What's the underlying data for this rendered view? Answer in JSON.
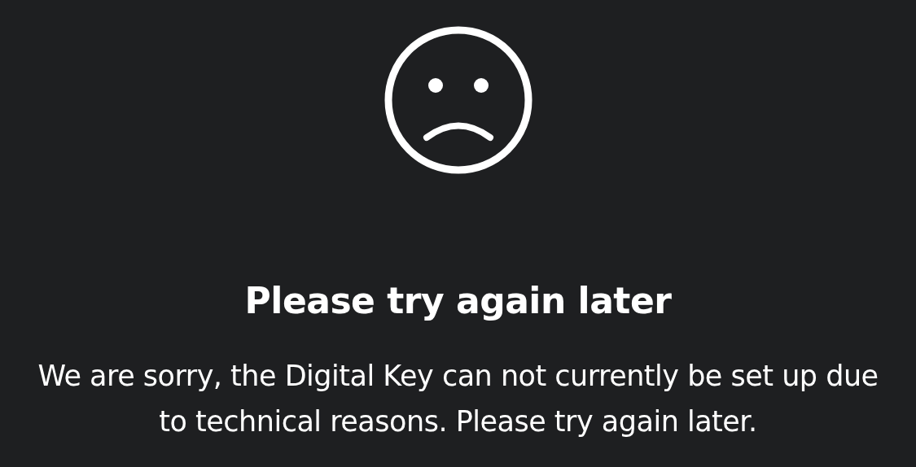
{
  "title": "Please try again later",
  "message": "We are sorry, the Digital Key can not currently be set up due to technical reasons. Please try again later."
}
